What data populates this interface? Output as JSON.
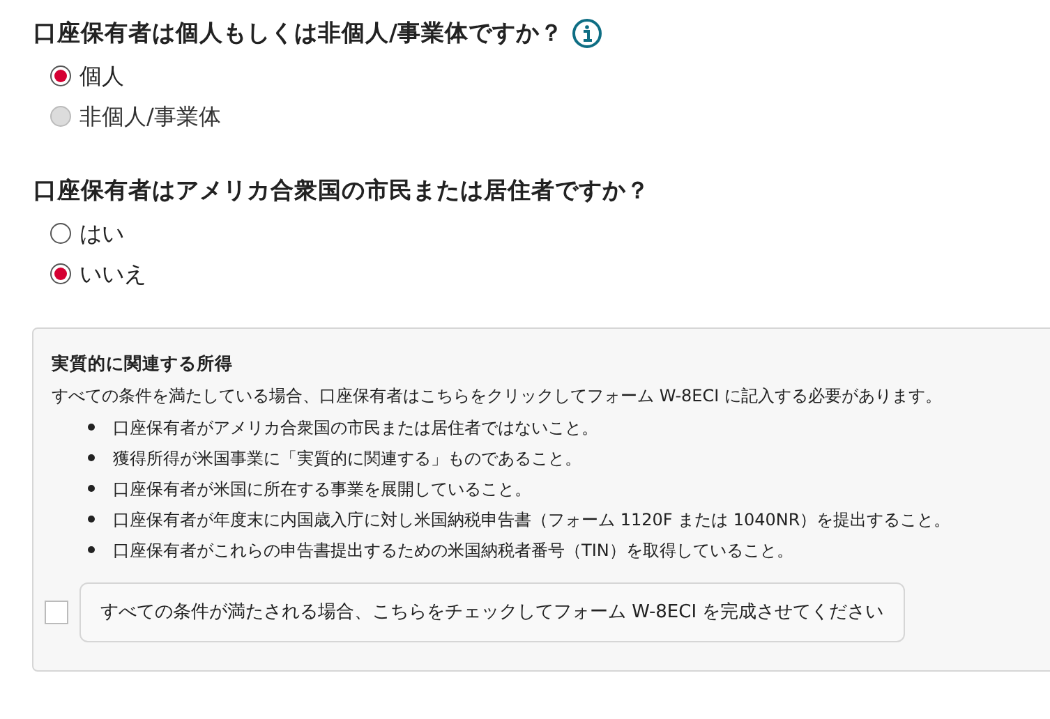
{
  "questions": [
    {
      "title": "口座保有者は個人もしくは非個人/事業体ですか？",
      "info": true,
      "options": [
        {
          "label": "個人",
          "selected": true,
          "disabled": false
        },
        {
          "label": "非個人/事業体",
          "selected": false,
          "disabled": true
        }
      ]
    },
    {
      "title": "口座保有者はアメリカ合衆国の市民または居住者ですか？",
      "info": false,
      "options": [
        {
          "label": "はい",
          "selected": false,
          "disabled": false
        },
        {
          "label": "いいえ",
          "selected": true,
          "disabled": false
        }
      ]
    }
  ],
  "panel": {
    "title": "実質的に関連する所得",
    "intro": "すべての条件を満たしている場合、口座保有者はこちらをクリックしてフォーム W-8ECI に記入する必要があります。",
    "conditions": [
      "口座保有者がアメリカ合衆国の市民または居住者ではないこと。",
      "獲得所得が米国事業に「実質的に関連する」ものであること。",
      "口座保有者が米国に所在する事業を展開していること。",
      "口座保有者が年度末に内国歳入庁に対し米国納税申告書（フォーム 1120F または 1040NR）を提出すること。",
      "口座保有者がこれらの申告書提出するための米国納税者番号（TIN）を取得していること。"
    ],
    "checkbox": {
      "label": "すべての条件が満たされる場合、こちらをチェックしてフォーム W-8ECI を完成させてください",
      "checked": false
    }
  }
}
